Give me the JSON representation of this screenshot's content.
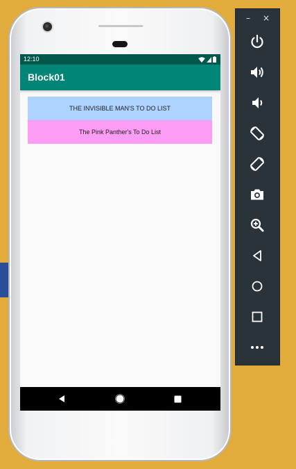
{
  "status_bar": {
    "time": "12:10"
  },
  "app": {
    "title": "Block01"
  },
  "list": {
    "items": [
      {
        "label": "THE INVISIBLE MAN'S TO DO LIST",
        "color": "#acd2fd"
      },
      {
        "label": "The Pink Panther's To Do List",
        "color": "#fc9cf4"
      }
    ]
  },
  "navigation": {
    "buttons": [
      "back-icon",
      "home-icon",
      "recents-icon"
    ]
  },
  "emulator_toolbar": {
    "window_controls": {
      "minimize": "–",
      "close": "×"
    },
    "tools": [
      "power-icon",
      "volume-up-icon",
      "volume-down-icon",
      "rotate-left-icon",
      "rotate-right-icon",
      "camera-icon",
      "zoom-icon",
      "back-icon",
      "home-icon",
      "overview-icon",
      "more-icon"
    ]
  },
  "colors": {
    "background": "#e2ac3c",
    "status_bar": "#00574b",
    "app_bar": "#008577",
    "toolbar": "#2b333a"
  }
}
